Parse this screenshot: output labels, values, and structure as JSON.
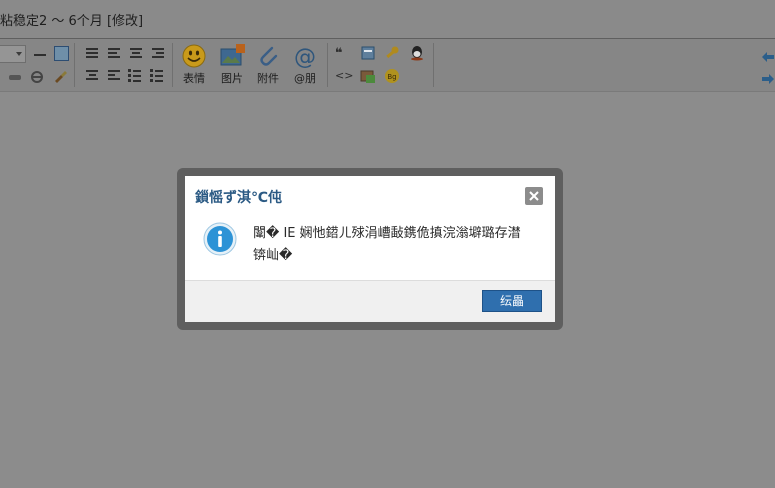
{
  "page": {
    "title": "粘稳定2 ～ 6个月 [修改]"
  },
  "toolbar": {
    "font_select_value": "",
    "big_buttons": [
      {
        "id": "emoji",
        "label": "表情",
        "icon": "smiley-icon"
      },
      {
        "id": "image",
        "label": "图片",
        "icon": "image-icon",
        "badge": "!"
      },
      {
        "id": "attach",
        "label": "附件",
        "icon": "paperclip-icon"
      },
      {
        "id": "mention",
        "label": "@朋",
        "icon": "at-icon"
      }
    ],
    "small_glyphs": {
      "quote": "❝",
      "code": "<>",
      "bg_badge": "Bg"
    }
  },
  "modal": {
    "title": "鎻愮ず淇℃伅",
    "message": "闈� IE 娴忚鍣ㄦ殏涓嶆敮鎸佹搷浣滃壀璐存澘",
    "message_line2": "锛屾�",
    "ok_label": "纭畾",
    "close_glyph": "×"
  },
  "colors": {
    "overlay_bg": "#8c8c8c",
    "modal_title": "#2b5a84",
    "primary_button": "#2f6fae",
    "info_icon": "#2d93d6"
  }
}
